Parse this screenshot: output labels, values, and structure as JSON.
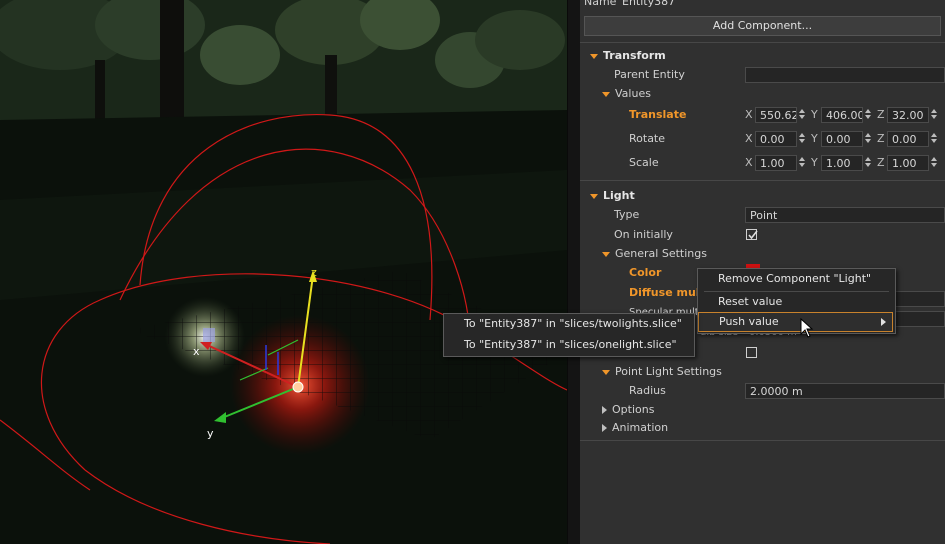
{
  "entity": {
    "name_label": "Name",
    "name_value": "Entity387"
  },
  "add_component": "Add Component...",
  "transform": {
    "header": "Transform",
    "parent_entity_label": "Parent Entity",
    "values_label": "Values",
    "translate": {
      "label": "Translate",
      "x": "550.62",
      "y": "406.00",
      "z": "32.00"
    },
    "rotate": {
      "label": "Rotate",
      "x": "0.00",
      "y": "0.00",
      "z": "0.00"
    },
    "scale": {
      "label": "Scale",
      "x": "1.00",
      "y": "1.00",
      "z": "1.00"
    },
    "axis_x": "X",
    "axis_y": "Y",
    "axis_z": "Z"
  },
  "light": {
    "header": "Light",
    "type_label": "Type",
    "type_value": "Point",
    "on_initially_label": "On initially",
    "general_settings": "General Settings",
    "color_label": "Color",
    "diffuse_label": "Diffuse mult",
    "specular_label": "Specular multi",
    "bulb_label": "ulb size",
    "bulb_value": "0.0500 m",
    "point_light_settings": "Point Light Settings",
    "radius_label": "Radius",
    "radius_value": "2.0000 m",
    "options_label": "Options",
    "animation_label": "Animation",
    "color_swatch": "#cc1111"
  },
  "context_menu": {
    "remove": "Remove Component \"Light\"",
    "reset": "Reset value",
    "push": "Push value"
  },
  "submenu": {
    "item1": "To \"Entity387\" in \"slices/twolights.slice\"",
    "item2": "To \"Entity387\" in \"slices/onelight.slice\""
  },
  "gizmo": {
    "x": "x",
    "y": "y",
    "z": "z"
  },
  "colors": {
    "accent": "#f0962a",
    "panel": "#303030",
    "light_sphere": "#e02020"
  }
}
